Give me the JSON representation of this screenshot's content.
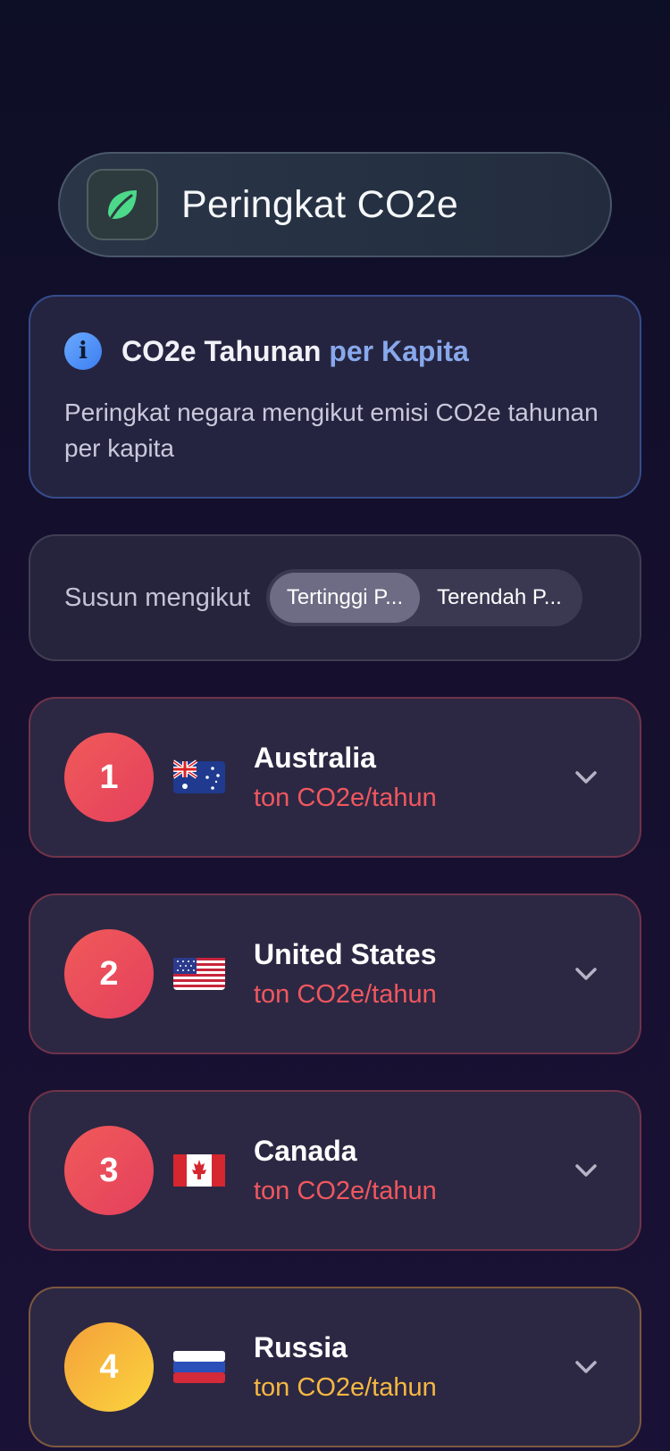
{
  "header": {
    "title": "Peringkat CO2e",
    "icon": "leaf-icon"
  },
  "info": {
    "icon": "info-icon",
    "icon_glyph": "i",
    "title_part1": "CO2e Tahunan ",
    "title_part2": "per Kapita",
    "description": "Peringkat negara mengikut emisi CO2e tahunan per kapita"
  },
  "sort": {
    "label": "Susun mengikut",
    "options": [
      "Tertinggi P...",
      "Terendah P..."
    ],
    "selected": "Tertinggi P..."
  },
  "rankings": [
    {
      "rank": "1",
      "country": "Australia",
      "unit": "ton CO2e/tahun",
      "flag": "australia-flag",
      "accent": "#f0575f"
    },
    {
      "rank": "2",
      "country": "United States",
      "unit": "ton CO2e/tahun",
      "flag": "usa-flag",
      "accent": "#f0575f"
    },
    {
      "rank": "3",
      "country": "Canada",
      "unit": "ton CO2e/tahun",
      "flag": "canada-flag",
      "accent": "#f0575f"
    },
    {
      "rank": "4",
      "country": "Russia",
      "unit": "ton CO2e/tahun",
      "flag": "russia-flag",
      "accent": "#f7b842"
    }
  ],
  "colors": {
    "background": "#0d0f26",
    "danger": "#f0575f",
    "warning": "#f7b842",
    "info_accent": "#88a8ec",
    "leaf": "#4cd98a"
  }
}
